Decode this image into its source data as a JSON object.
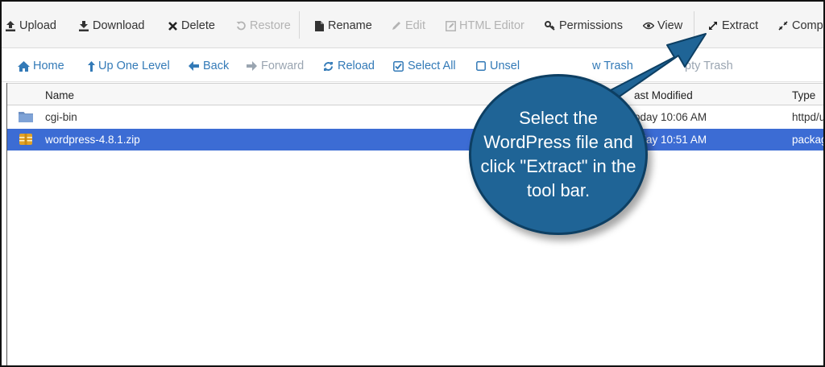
{
  "toolbar": {
    "items": [
      {
        "label": "Upload",
        "icon": "upload-icon",
        "disabled": false
      },
      {
        "label": "Download",
        "icon": "download-icon",
        "disabled": false
      },
      {
        "label": "Delete",
        "icon": "delete-icon",
        "disabled": false
      },
      {
        "label": "Restore",
        "icon": "restore-icon",
        "disabled": true
      },
      {
        "label": "Rename",
        "icon": "rename-icon",
        "disabled": false
      },
      {
        "label": "Edit",
        "icon": "edit-icon",
        "disabled": true
      },
      {
        "label": "HTML Editor",
        "icon": "html-editor-icon",
        "disabled": true
      },
      {
        "label": "Permissions",
        "icon": "permissions-icon",
        "disabled": false
      },
      {
        "label": "View",
        "icon": "view-icon",
        "disabled": false
      },
      {
        "label": "Extract",
        "icon": "extract-icon",
        "disabled": false
      },
      {
        "label": "Compr",
        "icon": "compress-icon",
        "disabled": false
      }
    ]
  },
  "navbar": {
    "items": [
      {
        "label": "Home",
        "icon": "home-icon",
        "disabled": false
      },
      {
        "label": "Up One Level",
        "icon": "up-level-icon",
        "disabled": false
      },
      {
        "label": "Back",
        "icon": "back-arrow-icon",
        "disabled": false
      },
      {
        "label": "Forward",
        "icon": "forward-arrow-icon",
        "disabled": true
      },
      {
        "label": "Reload",
        "icon": "reload-icon",
        "disabled": false
      },
      {
        "label": "Select All",
        "icon": "select-all-icon",
        "disabled": false
      },
      {
        "label": "Unsel",
        "icon": "unselect-icon",
        "disabled": false
      },
      {
        "label": "w Trash",
        "icon": "",
        "disabled": false
      },
      {
        "label": "pty Trash",
        "icon": "",
        "disabled": true
      }
    ]
  },
  "table": {
    "columns": {
      "name": "Name",
      "modified": "ast Modified",
      "type": "Type"
    },
    "rows": [
      {
        "name": "cgi-bin",
        "modified": "oday 10:06 AM",
        "type": "httpd/u",
        "icon": "folder-icon",
        "selected": false
      },
      {
        "name": "wordpress-4.8.1.zip",
        "modified": "oday 10:51 AM",
        "type": "packag",
        "icon": "archive-icon",
        "selected": true
      }
    ]
  },
  "callout": {
    "text": "Select the WordPress file and click \"Extract\" in the tool bar."
  },
  "colors": {
    "link": "#337ab7",
    "selected_row": "#3c6cd4",
    "callout_fill": "#1f6496"
  }
}
